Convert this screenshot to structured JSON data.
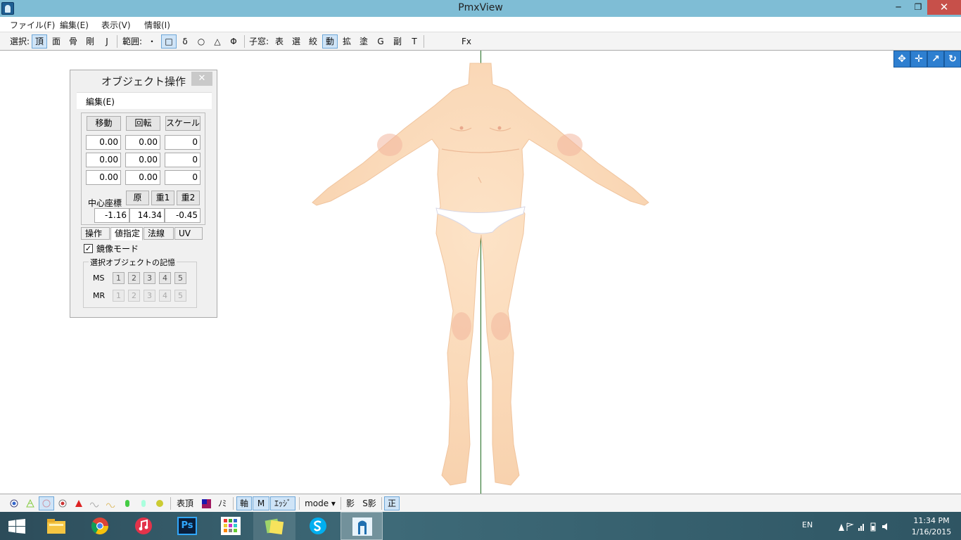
{
  "window": {
    "title": "PmxView",
    "min_symbol": "─",
    "max_symbol": "❐",
    "close_symbol": "✕"
  },
  "menu": [
    "ファイル(F)",
    "編集(E)",
    "表示(V)",
    "情報(I)"
  ],
  "toolbar": {
    "select_label": "選択:",
    "select_items": [
      "頂",
      "面",
      "骨",
      "剛",
      "J"
    ],
    "range_label": "範囲:",
    "range_items": [
      "・",
      "□",
      "δ",
      "○",
      "△",
      "Φ"
    ],
    "child_label": "子窓:",
    "child_items": [
      "表",
      "選",
      "絞",
      "動",
      "拡",
      "塗",
      "G",
      "副",
      "T"
    ],
    "fx_label": "Fx"
  },
  "view_nav": {
    "icons": [
      "move-xy-icon",
      "move-all-icon",
      "zoom-icon",
      "rotate-icon"
    ],
    "glyphs": [
      "✥",
      "✛",
      "↗",
      "↻"
    ]
  },
  "object_panel": {
    "title": "オブジェクト操作",
    "close": "✕",
    "menu": "編集(E)",
    "buttons": [
      "移動",
      "回転",
      "スケール"
    ],
    "rows": [
      [
        "0.00",
        "0.00",
        "0"
      ],
      [
        "0.00",
        "0.00",
        "0"
      ],
      [
        "0.00",
        "0.00",
        "0"
      ]
    ],
    "center_label": "中心座標",
    "center_buttons": [
      "原",
      "重1",
      "重2"
    ],
    "center_values": [
      "-1.16",
      "14.34",
      "-0.45"
    ],
    "tabs": [
      "操作",
      "値指定",
      "法線",
      "UV"
    ],
    "mirror_check": "✓",
    "mirror_label": "鏡像モード",
    "memory_title": "選択オブジェクトの記憶",
    "ms_label": "MS",
    "mr_label": "MR",
    "slots": [
      "1",
      "2",
      "3",
      "4",
      "5"
    ]
  },
  "bottom_toolbar": {
    "vertex_label": "表頂",
    "nomi_label": "ﾉﾐ",
    "axis_label": "軸",
    "mat_label": "M",
    "edge_label": "ｴｯｼﾞ",
    "mode_label": "mode ▾",
    "shadow_label": "影",
    "sshadow_label": "S影",
    "front_label": "正"
  },
  "taskbar": {
    "apps": [
      "windows-start",
      "file-explorer",
      "chrome",
      "itunes",
      "photoshop",
      "apps-grid",
      "sticky-notes",
      "skype",
      "pmxview"
    ],
    "ps_label": "Ps",
    "lang": "EN",
    "time": "11:34 PM",
    "date": "1/16/2015"
  },
  "colors": {
    "titlebar": "#7fbdd5",
    "skin": "#fbd9b8",
    "axis": "#1e6b1e",
    "toggle_on": "#cfe4f7"
  }
}
